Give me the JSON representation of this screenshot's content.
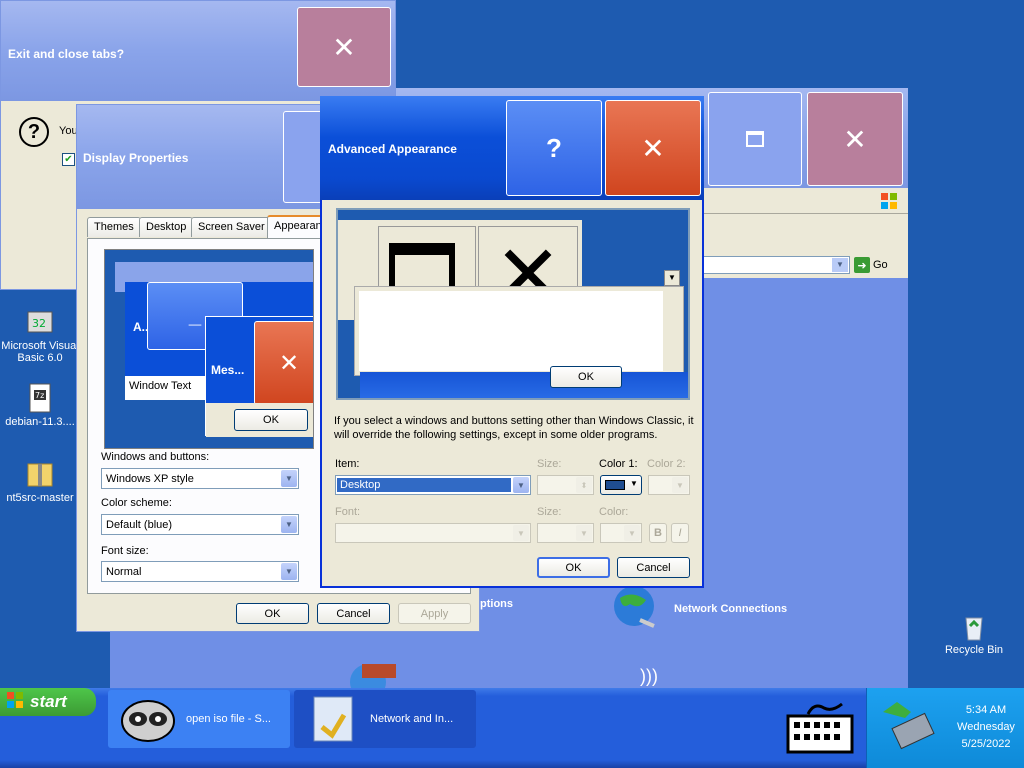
{
  "background_window": {
    "title": "Exit and close tabs?",
    "message_prefix": "You"
  },
  "explorer_window": {
    "go_label": "Go",
    "items": [
      "Network Connections"
    ],
    "partial_item": "ptions"
  },
  "display_properties": {
    "title": "Display Properties",
    "tabs": [
      "Themes",
      "Desktop",
      "Screen Saver",
      "Appearance"
    ],
    "preview": {
      "active_title": "A...",
      "message_title": "Mes...",
      "window_text": "Window Text",
      "ok_label": "OK"
    },
    "windows_buttons_label": "Windows and buttons:",
    "windows_buttons_value": "Windows XP style",
    "color_scheme_label": "Color scheme:",
    "color_scheme_value": "Default (blue)",
    "font_size_label": "Font size:",
    "font_size_value": "Normal",
    "ok_label": "OK",
    "cancel_label": "Cancel",
    "apply_label": "Apply"
  },
  "advanced_appearance": {
    "title": "Advanced Appearance",
    "help_glyph": "?",
    "preview_ok": "OK",
    "notice": "If you select a windows and buttons setting other than Windows Classic, it will override the following settings, except in some older programs.",
    "item_label": "Item:",
    "item_value": "Desktop",
    "size_label": "Size:",
    "color1_label": "Color 1:",
    "color2_label": "Color 2:",
    "font_label": "Font:",
    "font_size_label": "Size:",
    "font_color_label": "Color:",
    "bold_glyph": "B",
    "italic_glyph": "I",
    "ok_label": "OK",
    "cancel_label": "Cancel",
    "color1_swatch": "#1f4d91"
  },
  "desktop_icons": [
    {
      "label": "Microsoft Visual Basic 6.0"
    },
    {
      "label": "debian-11.3...."
    },
    {
      "label": "nt5src-master"
    },
    {
      "label": "Recycle Bin"
    }
  ],
  "taskbar": {
    "start_label": "start",
    "tasks": [
      {
        "label": "open iso file - S..."
      },
      {
        "label": "Network and In..."
      }
    ],
    "clock": {
      "time": "5:34 AM",
      "day": "Wednesday",
      "date": "5/25/2022"
    }
  },
  "colors": {
    "desktop": "#1e5bb0",
    "taskbar": "#245edb",
    "start": "#3c9b34"
  }
}
